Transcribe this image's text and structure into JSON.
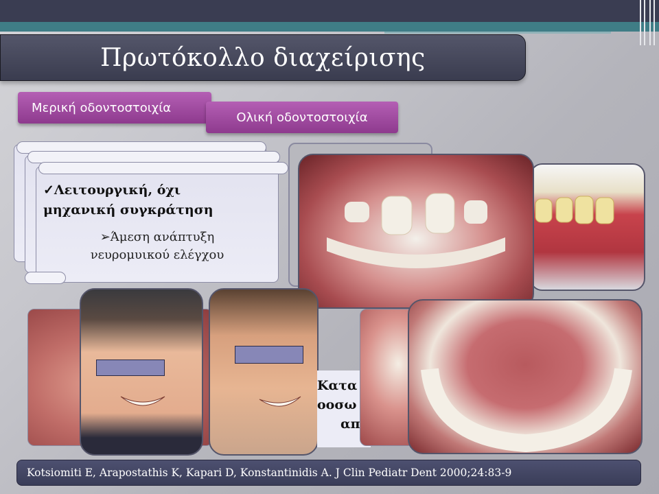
{
  "slide": {
    "title": "Πρωτόκολλο διαχείρισης",
    "tabs": {
      "partial": "Μερική οδοντοστοιχία",
      "total": "Ολική οδοντοστοιχία"
    },
    "scroll": {
      "heading_line1": "✓Λειτουργική, όχι",
      "heading_line2": "μηχανική συγκράτηση",
      "bullet_line1": "➢Άμεση ανάπτυξη",
      "bullet_line2": "νευρομυικού ελέγχου"
    },
    "behind_text": {
      "line1": "Κατα",
      "line2": "οοσω",
      "line3": "απ"
    },
    "citation": "Kotsiomiti E, Arapostathis K, Kapari D, Konstantinidis A. J Clin Pediatr Dent 2000;24:83-9"
  },
  "colors": {
    "title_bar": "#3a3c4f",
    "tab_purple": "#9c479c",
    "teal": "#3f7d86",
    "eye_bar": "#8787b7"
  }
}
